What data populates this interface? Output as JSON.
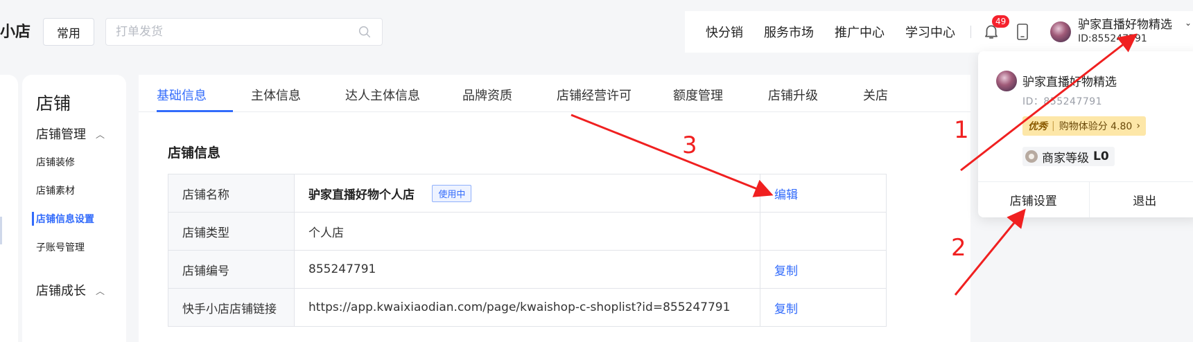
{
  "header": {
    "logo_text": "小店",
    "common_button": "常用",
    "search_placeholder": "打单发货",
    "nav_links": [
      "快分销",
      "服务市场",
      "推广中心",
      "学习中心"
    ],
    "notification_count": "49",
    "user_name": "驴家直播好物精选",
    "user_id": "ID:855247791"
  },
  "sidebar": {
    "title": "店铺",
    "group1": "店铺管理",
    "items": [
      "店铺装修",
      "店铺素材",
      "店铺信息设置",
      "子账号管理"
    ],
    "group2": "店铺成长"
  },
  "tabs": [
    "基础信息",
    "主体信息",
    "达人主体信息",
    "品牌资质",
    "店铺经营许可",
    "额度管理",
    "店铺升级",
    "关店"
  ],
  "section_title": "店铺信息",
  "table": {
    "rows": [
      {
        "label": "店铺名称",
        "value": "驴家直播好物个人店",
        "tag": "使用中",
        "action": "编辑"
      },
      {
        "label": "店铺类型",
        "value": "个人店",
        "action": ""
      },
      {
        "label": "店铺编号",
        "value": "855247791",
        "action": "复制"
      },
      {
        "label": "快手小店店铺链接",
        "value": "https://app.kwaixiaodian.com/page/kwaishop-c-shoplist?id=855247791",
        "action": "复制"
      }
    ]
  },
  "popover": {
    "name": "驴家直播好物精选",
    "id": "ID：855247791",
    "tier": "优秀",
    "rating_label": "购物体验分 4.80",
    "level_label": "商家等级",
    "level_value": "L0",
    "buttons": [
      "店铺设置",
      "退出"
    ]
  },
  "annotations": [
    "1",
    "2",
    "3"
  ],
  "colors": {
    "accent": "#326bfb",
    "annotation": "#f02020",
    "badge": "#f5222d"
  }
}
